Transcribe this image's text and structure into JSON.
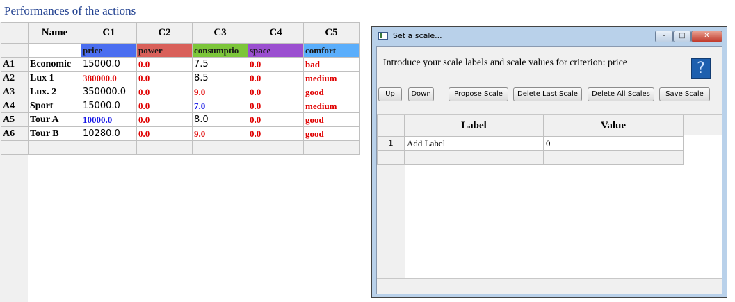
{
  "page": {
    "title": "Performances of the actions"
  },
  "performance_table": {
    "column_headers": [
      "Name",
      "C1",
      "C2",
      "C3",
      "C4",
      "C5"
    ],
    "criteria": [
      {
        "label": "price",
        "color": "#4a6ef0"
      },
      {
        "label": "power",
        "color": "#d9605a"
      },
      {
        "label": "consumptio",
        "color": "#7cc63a"
      },
      {
        "label": "space",
        "color": "#9b4fd0"
      },
      {
        "label": "comfort",
        "color": "#5aaefc"
      }
    ],
    "rows": [
      {
        "id": "A1",
        "name": "Economic",
        "values": [
          "15000.0",
          "0.0",
          "7.5",
          "0.0",
          "bad"
        ],
        "styles": [
          "plain",
          "red",
          "plain",
          "red",
          "red"
        ]
      },
      {
        "id": "A2",
        "name": "Lux 1",
        "values": [
          "380000.0",
          "0.0",
          "8.5",
          "0.0",
          "medium"
        ],
        "styles": [
          "red",
          "red",
          "plain",
          "red",
          "red"
        ]
      },
      {
        "id": "A3",
        "name": "Lux. 2",
        "values": [
          "350000.0",
          "0.0",
          "9.0",
          "0.0",
          "good"
        ],
        "styles": [
          "plain",
          "red",
          "red",
          "red",
          "red"
        ]
      },
      {
        "id": "A4",
        "name": "Sport",
        "values": [
          "15000.0",
          "0.0",
          "7.0",
          "0.0",
          "medium"
        ],
        "styles": [
          "plain",
          "red",
          "blue",
          "red",
          "red"
        ]
      },
      {
        "id": "A5",
        "name": "Tour A",
        "values": [
          "10000.0",
          "0.0",
          "8.0",
          "0.0",
          "good"
        ],
        "styles": [
          "blue",
          "red",
          "plain",
          "red",
          "red"
        ]
      },
      {
        "id": "A6",
        "name": "Tour B",
        "values": [
          "10280.0",
          "0.0",
          "9.0",
          "0.0",
          "good"
        ],
        "styles": [
          "plain",
          "red",
          "red",
          "red",
          "red"
        ]
      }
    ]
  },
  "dialog": {
    "title": "Set a scale...",
    "window_buttons": {
      "minimize": "–",
      "maximize": "□",
      "close": "✕"
    },
    "prompt": "Introduce your scale labels and scale values for criterion:  price",
    "help_icon": "?",
    "buttons": {
      "up": "Up",
      "down": "Down",
      "propose": "Propose Scale",
      "delete_last": "Delete Last Scale",
      "delete_all": "Delete All Scales",
      "save": "Save Scale"
    },
    "scale_table": {
      "headers": [
        "Label",
        "Value"
      ],
      "rows": [
        {
          "index": "1",
          "label": "Add Label",
          "value": "0"
        }
      ]
    }
  }
}
